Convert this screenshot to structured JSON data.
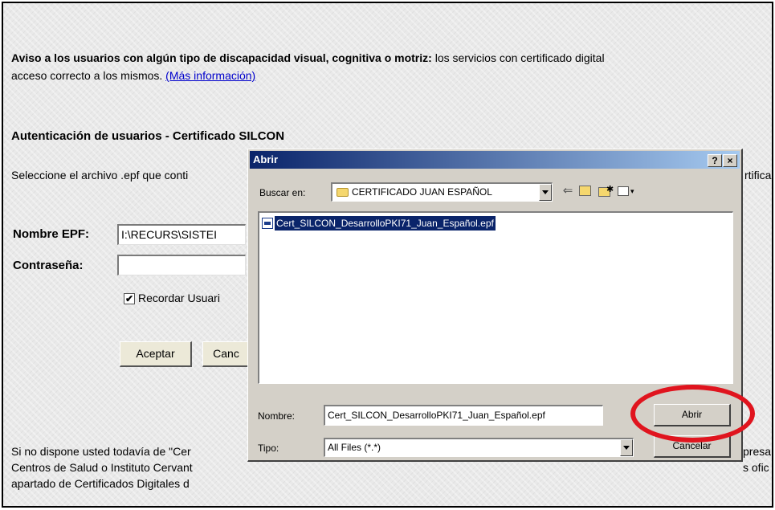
{
  "page": {
    "notice_bold": "Aviso a los usuarios con algún tipo de discapacidad visual, cognitiva o motriz:",
    "notice_rest": " los servicios con certificado digital",
    "notice_line2": "acceso correcto a los mismos. ",
    "notice_link": "(Más información)",
    "auth_heading": "Autenticación de usuarios - Certificado SILCON",
    "select_text_left": "Seleccione el archivo .epf que conti",
    "select_text_right": "rtifica",
    "epf_label": "Nombre EPF:",
    "epf_value": "I:\\RECURS\\SISTEI",
    "password_label": "Contraseña:",
    "password_value": "",
    "remember_label": "Recordar Usuari",
    "remember_checked": "✔",
    "accept_label": "Aceptar",
    "cancel_label": "Canc",
    "footer_line1": "Si no dispone usted todavía de \"Cer",
    "footer_line2": "Centros de Salud o Instituto Cervant",
    "footer_line3": "apartado de Certificados Digitales d",
    "footer_r1": "presa",
    "footer_r2": "s ofic"
  },
  "dialog": {
    "title": "Abrir",
    "help_btn": "?",
    "close_btn": "×",
    "lookin_label": "Buscar en:",
    "lookin_value": "CERTIFICADO JUAN ESPAÑOL",
    "files": [
      "Cert_SILCON_DesarrolloPKI71_Juan_Español.epf"
    ],
    "name_label": "Nombre:",
    "name_value": "Cert_SILCON_DesarrolloPKI71_Juan_Español.epf",
    "type_label": "Tipo:",
    "type_value": "All Files (*.*)",
    "open_button": "Abrir",
    "cancel_button": "Cancelar",
    "toolbar_icons": [
      "back-arrow-icon",
      "up-folder-icon",
      "new-folder-icon",
      "view-menu-icon"
    ],
    "highlight_color": "#e0141e"
  }
}
